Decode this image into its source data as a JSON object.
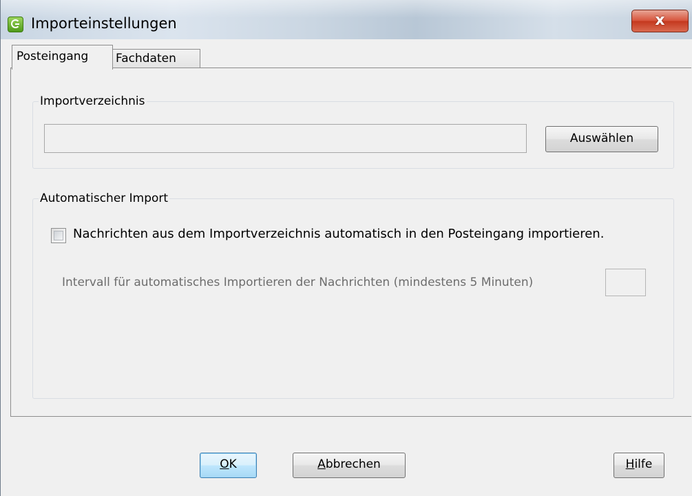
{
  "window": {
    "title": "Importeinstellungen",
    "app_icon": "app-logo-icon",
    "close_glyph": "x"
  },
  "tabs": [
    {
      "label": "Posteingang",
      "selected": true
    },
    {
      "label": "Fachdaten",
      "selected": false
    }
  ],
  "import_directory": {
    "group_label": "Importverzeichnis",
    "path_value": "",
    "select_button": "Auswählen"
  },
  "auto_import": {
    "group_label": "Automatischer Import",
    "checkbox_label": "Nachrichten aus dem Importverzeichnis automatisch in den Posteingang importieren.",
    "checked": false,
    "interval_label": "Intervall für automatisches Importieren der Nachrichten (mindestens 5 Minuten)",
    "interval_value": ""
  },
  "footer": {
    "ok": {
      "mnemonic": "O",
      "rest": "K"
    },
    "cancel": {
      "mnemonic": "A",
      "rest": "bbrechen"
    },
    "help": {
      "mnemonic": "H",
      "rest": "ilfe"
    }
  },
  "colors": {
    "window_bg": "#f0f0f0",
    "close_button": "#c4391f",
    "default_button": "#bee6fd",
    "disabled_text": "#6d6d6d"
  }
}
